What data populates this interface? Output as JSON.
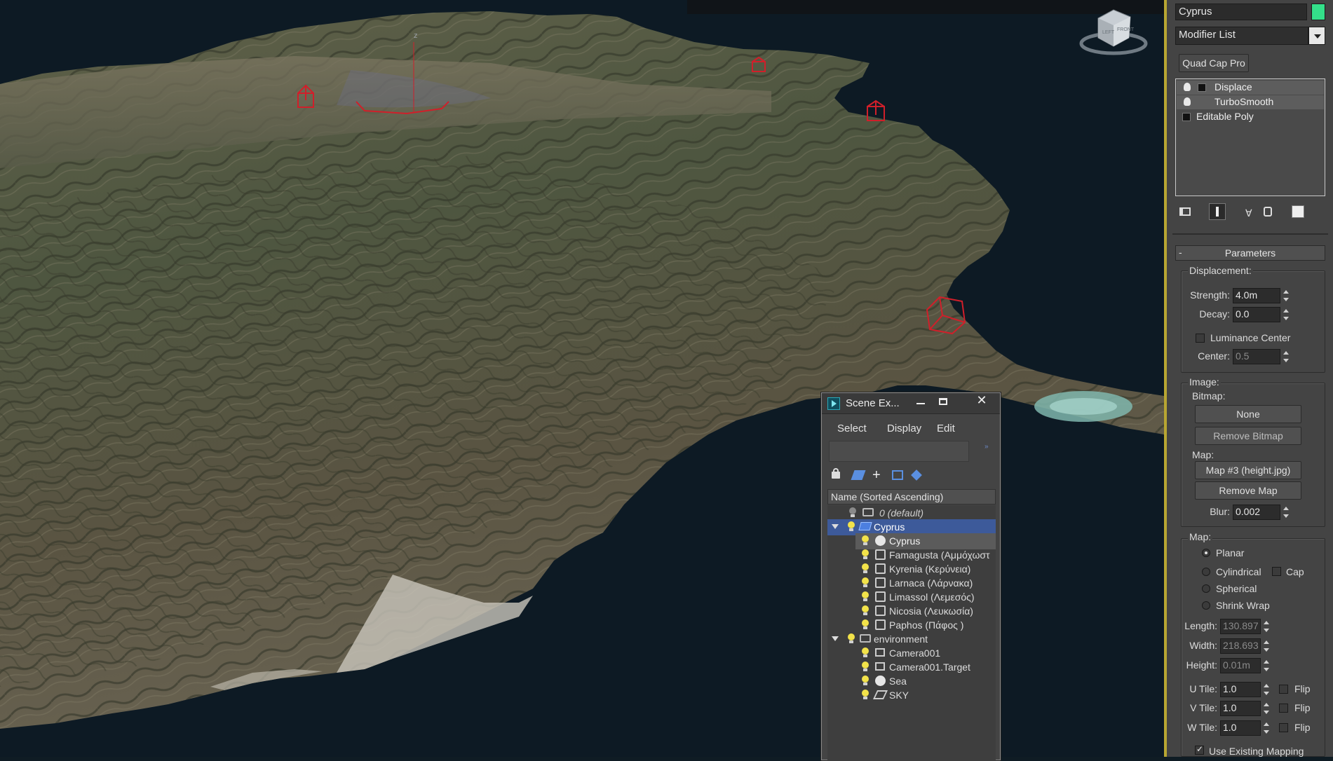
{
  "command_panel": {
    "object_name": "Cyprus",
    "object_color": "#34e08a",
    "modifier_list": "Modifier List",
    "quad_cap_button": "Quad Cap Pro",
    "modifier_stack": [
      {
        "label": "Displace"
      },
      {
        "label": "TurboSmooth"
      },
      {
        "label": "Editable Poly"
      }
    ],
    "rollout_title": "Parameters",
    "displacement": {
      "group": "Displacement:",
      "strength_label": "Strength:",
      "strength": "4.0m",
      "decay_label": "Decay:",
      "decay": "0.0",
      "luminance_center": "Luminance Center",
      "center_label": "Center:",
      "center": "0.5"
    },
    "image": {
      "group": "Image:",
      "bitmap_label": "Bitmap:",
      "bitmap_button": "None",
      "remove_bitmap": "Remove Bitmap",
      "map_label": "Map:",
      "map_button": "Map #3 (height.jpg)",
      "remove_map": "Remove Map",
      "blur_label": "Blur:",
      "blur": "0.002"
    },
    "map": {
      "group": "Map:",
      "planar": "Planar",
      "cylindrical": "Cylindrical",
      "cap": "Cap",
      "spherical": "Spherical",
      "shrink_wrap": "Shrink Wrap",
      "length_label": "Length:",
      "length": "130.897",
      "width_label": "Width:",
      "width": "218.693",
      "height_label": "Height:",
      "height": "0.01m",
      "utile_label": "U Tile:",
      "utile": "1.0",
      "vtile_label": "V Tile:",
      "vtile": "1.0",
      "wtile_label": "W Tile:",
      "wtile": "1.0",
      "flip": "Flip",
      "use_existing": "Use Existing Mapping"
    }
  },
  "scene_explorer": {
    "title": "Scene Ex...",
    "menu": [
      "Select",
      "Display",
      "Edit"
    ],
    "column_header": "Name (Sorted Ascending)",
    "rows": [
      {
        "label": "0 (default)"
      },
      {
        "label": "Cyprus"
      },
      {
        "label": "Cyprus"
      },
      {
        "label": "Famagusta (Αμμόχωστ"
      },
      {
        "label": "Kyrenia (Κερύνεια)"
      },
      {
        "label": "Larnaca (Λάρνακα)"
      },
      {
        "label": "Limassol (Λεμεσός)"
      },
      {
        "label": "Nicosia (Λευκωσία)"
      },
      {
        "label": "Paphos (Πάφος )"
      },
      {
        "label": "environment"
      },
      {
        "label": "Camera001"
      },
      {
        "label": "Camera001.Target"
      },
      {
        "label": "Sea"
      },
      {
        "label": "SKY"
      }
    ]
  },
  "viewport": {
    "axis_label": "z",
    "viewcube_faces": [
      "LEFT",
      "FRONT"
    ]
  }
}
